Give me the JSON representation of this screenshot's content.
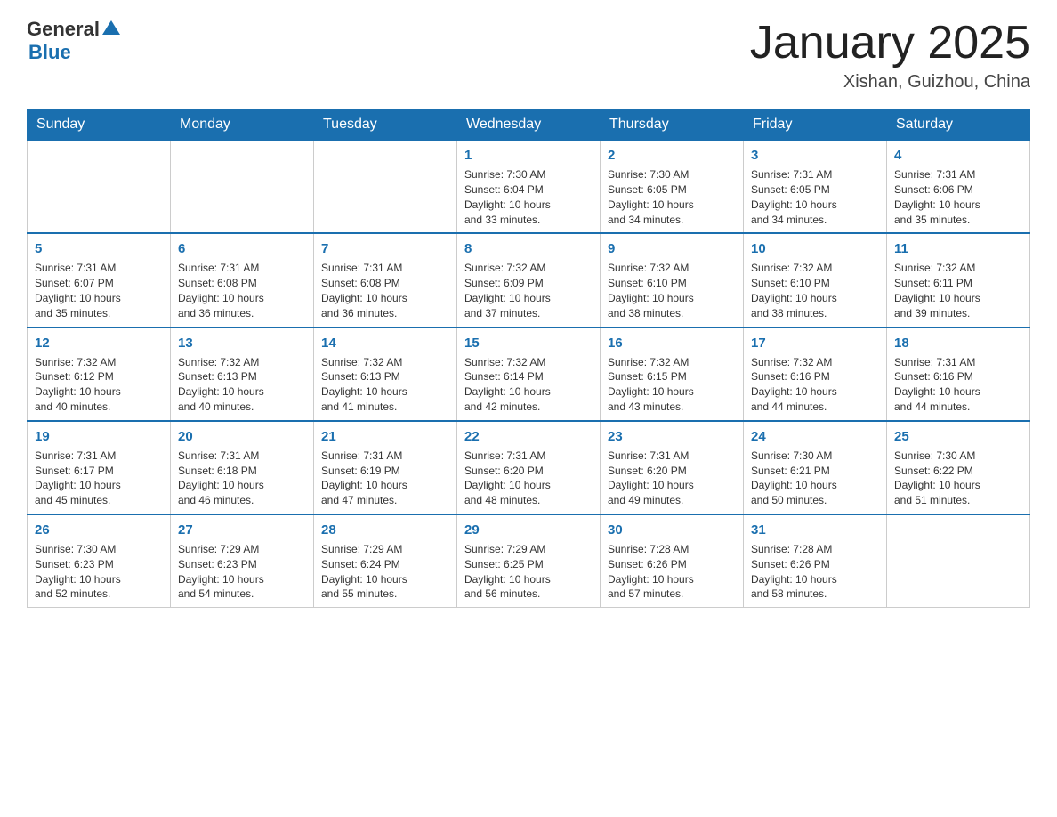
{
  "header": {
    "logo": {
      "general": "General",
      "blue": "Blue",
      "arrow": "▲"
    },
    "title": "January 2025",
    "subtitle": "Xishan, Guizhou, China"
  },
  "weekdays": [
    "Sunday",
    "Monday",
    "Tuesday",
    "Wednesday",
    "Thursday",
    "Friday",
    "Saturday"
  ],
  "weeks": [
    [
      {
        "day": "",
        "info": ""
      },
      {
        "day": "",
        "info": ""
      },
      {
        "day": "",
        "info": ""
      },
      {
        "day": "1",
        "info": "Sunrise: 7:30 AM\nSunset: 6:04 PM\nDaylight: 10 hours\nand 33 minutes."
      },
      {
        "day": "2",
        "info": "Sunrise: 7:30 AM\nSunset: 6:05 PM\nDaylight: 10 hours\nand 34 minutes."
      },
      {
        "day": "3",
        "info": "Sunrise: 7:31 AM\nSunset: 6:05 PM\nDaylight: 10 hours\nand 34 minutes."
      },
      {
        "day": "4",
        "info": "Sunrise: 7:31 AM\nSunset: 6:06 PM\nDaylight: 10 hours\nand 35 minutes."
      }
    ],
    [
      {
        "day": "5",
        "info": "Sunrise: 7:31 AM\nSunset: 6:07 PM\nDaylight: 10 hours\nand 35 minutes."
      },
      {
        "day": "6",
        "info": "Sunrise: 7:31 AM\nSunset: 6:08 PM\nDaylight: 10 hours\nand 36 minutes."
      },
      {
        "day": "7",
        "info": "Sunrise: 7:31 AM\nSunset: 6:08 PM\nDaylight: 10 hours\nand 36 minutes."
      },
      {
        "day": "8",
        "info": "Sunrise: 7:32 AM\nSunset: 6:09 PM\nDaylight: 10 hours\nand 37 minutes."
      },
      {
        "day": "9",
        "info": "Sunrise: 7:32 AM\nSunset: 6:10 PM\nDaylight: 10 hours\nand 38 minutes."
      },
      {
        "day": "10",
        "info": "Sunrise: 7:32 AM\nSunset: 6:10 PM\nDaylight: 10 hours\nand 38 minutes."
      },
      {
        "day": "11",
        "info": "Sunrise: 7:32 AM\nSunset: 6:11 PM\nDaylight: 10 hours\nand 39 minutes."
      }
    ],
    [
      {
        "day": "12",
        "info": "Sunrise: 7:32 AM\nSunset: 6:12 PM\nDaylight: 10 hours\nand 40 minutes."
      },
      {
        "day": "13",
        "info": "Sunrise: 7:32 AM\nSunset: 6:13 PM\nDaylight: 10 hours\nand 40 minutes."
      },
      {
        "day": "14",
        "info": "Sunrise: 7:32 AM\nSunset: 6:13 PM\nDaylight: 10 hours\nand 41 minutes."
      },
      {
        "day": "15",
        "info": "Sunrise: 7:32 AM\nSunset: 6:14 PM\nDaylight: 10 hours\nand 42 minutes."
      },
      {
        "day": "16",
        "info": "Sunrise: 7:32 AM\nSunset: 6:15 PM\nDaylight: 10 hours\nand 43 minutes."
      },
      {
        "day": "17",
        "info": "Sunrise: 7:32 AM\nSunset: 6:16 PM\nDaylight: 10 hours\nand 44 minutes."
      },
      {
        "day": "18",
        "info": "Sunrise: 7:31 AM\nSunset: 6:16 PM\nDaylight: 10 hours\nand 44 minutes."
      }
    ],
    [
      {
        "day": "19",
        "info": "Sunrise: 7:31 AM\nSunset: 6:17 PM\nDaylight: 10 hours\nand 45 minutes."
      },
      {
        "day": "20",
        "info": "Sunrise: 7:31 AM\nSunset: 6:18 PM\nDaylight: 10 hours\nand 46 minutes."
      },
      {
        "day": "21",
        "info": "Sunrise: 7:31 AM\nSunset: 6:19 PM\nDaylight: 10 hours\nand 47 minutes."
      },
      {
        "day": "22",
        "info": "Sunrise: 7:31 AM\nSunset: 6:20 PM\nDaylight: 10 hours\nand 48 minutes."
      },
      {
        "day": "23",
        "info": "Sunrise: 7:31 AM\nSunset: 6:20 PM\nDaylight: 10 hours\nand 49 minutes."
      },
      {
        "day": "24",
        "info": "Sunrise: 7:30 AM\nSunset: 6:21 PM\nDaylight: 10 hours\nand 50 minutes."
      },
      {
        "day": "25",
        "info": "Sunrise: 7:30 AM\nSunset: 6:22 PM\nDaylight: 10 hours\nand 51 minutes."
      }
    ],
    [
      {
        "day": "26",
        "info": "Sunrise: 7:30 AM\nSunset: 6:23 PM\nDaylight: 10 hours\nand 52 minutes."
      },
      {
        "day": "27",
        "info": "Sunrise: 7:29 AM\nSunset: 6:23 PM\nDaylight: 10 hours\nand 54 minutes."
      },
      {
        "day": "28",
        "info": "Sunrise: 7:29 AM\nSunset: 6:24 PM\nDaylight: 10 hours\nand 55 minutes."
      },
      {
        "day": "29",
        "info": "Sunrise: 7:29 AM\nSunset: 6:25 PM\nDaylight: 10 hours\nand 56 minutes."
      },
      {
        "day": "30",
        "info": "Sunrise: 7:28 AM\nSunset: 6:26 PM\nDaylight: 10 hours\nand 57 minutes."
      },
      {
        "day": "31",
        "info": "Sunrise: 7:28 AM\nSunset: 6:26 PM\nDaylight: 10 hours\nand 58 minutes."
      },
      {
        "day": "",
        "info": ""
      }
    ]
  ]
}
